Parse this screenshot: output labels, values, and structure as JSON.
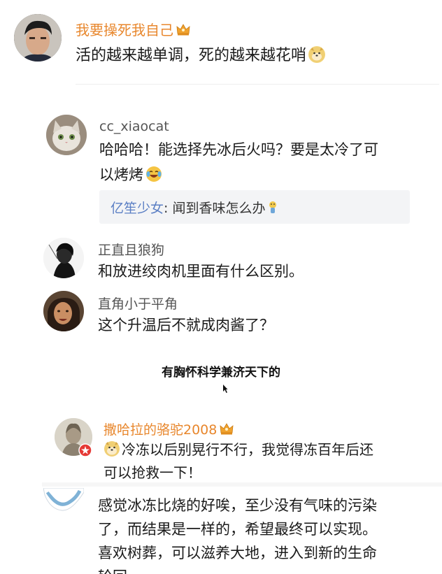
{
  "comment1": {
    "username": "我要操死我自己",
    "text": "活的越来越单调，死的越来越花哨",
    "name_color": "#e8872d",
    "emoji": "doge-emoji"
  },
  "reply1": {
    "username": "cc_xiaocat",
    "text_line1": "哈哈哈！能选择先冰后火吗？要是太冷了可",
    "text_line2": "以烤烤",
    "emoji": "laugh-cry-emoji",
    "sub_reply": {
      "username": "亿笙少女",
      "separator": ": ",
      "text": "闻到香味怎么办",
      "name_color": "#5b7fc4",
      "emoji": "drool-emoji"
    }
  },
  "reply2": {
    "username": "正直且狼狗",
    "text": "和放进绞肉机里面有什么区别。"
  },
  "reply3": {
    "username": "直角小于平角",
    "text": "这个升温后不就成肉酱了？"
  },
  "caption": {
    "text": "有胸怀科学兼济天下的"
  },
  "comment2": {
    "username": "撒哈拉的骆驼2008",
    "name_color": "#e8872d",
    "text_line1": "冷冻以后别晃行不行，我觉得冻百年后还",
    "text_line2": "可以抢救一下！",
    "emoji": "doge-emoji"
  },
  "comment3": {
    "line1": "感觉冰冻比烧的好唉，至少没有气味的污染",
    "line2": "了，而结果是一样的，希望最终可以实现。",
    "line3": "喜欢树葬，可以滋养大地，进入到新的生命",
    "line4": "轮回。"
  },
  "colors": {
    "username_gray": "#555555",
    "text": "#1b1b1b",
    "vip_orange": "#e8872d",
    "link_blue": "#5b7fc4",
    "card_bg": "#f3f4f6"
  }
}
